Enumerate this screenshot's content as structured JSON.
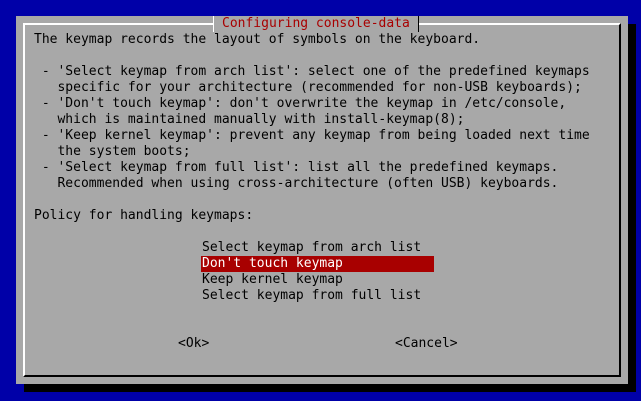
{
  "dialog": {
    "title": "Configuring console-data",
    "description": [
      "The keymap records the layout of symbols on the keyboard.",
      "",
      " - 'Select keymap from arch list': select one of the predefined keymaps",
      "   specific for your architecture (recommended for non-USB keyboards);",
      " - 'Don't touch keymap': don't overwrite the keymap in /etc/console,",
      "   which is maintained manually with install-keymap(8);",
      " - 'Keep kernel keymap': prevent any keymap from being loaded next time",
      "   the system boots;",
      " - 'Select keymap from full list': list all the predefined keymaps.",
      "   Recommended when using cross-architecture (often USB) keyboards.",
      "",
      "Policy for handling keymaps:"
    ],
    "options": [
      "Select keymap from arch list",
      "Don't touch keymap",
      "Keep kernel keymap",
      "Select keymap from full list"
    ],
    "selected_option": "Don't touch keymap",
    "ok_label": "<Ok>",
    "cancel_label": "<Cancel>"
  },
  "colors": {
    "background": "#0000a8",
    "dialog": "#a8a8a8",
    "title": "#a80000",
    "highlight": "#a80000",
    "highlight_text": "#ffffff",
    "shadow": "#000000"
  }
}
